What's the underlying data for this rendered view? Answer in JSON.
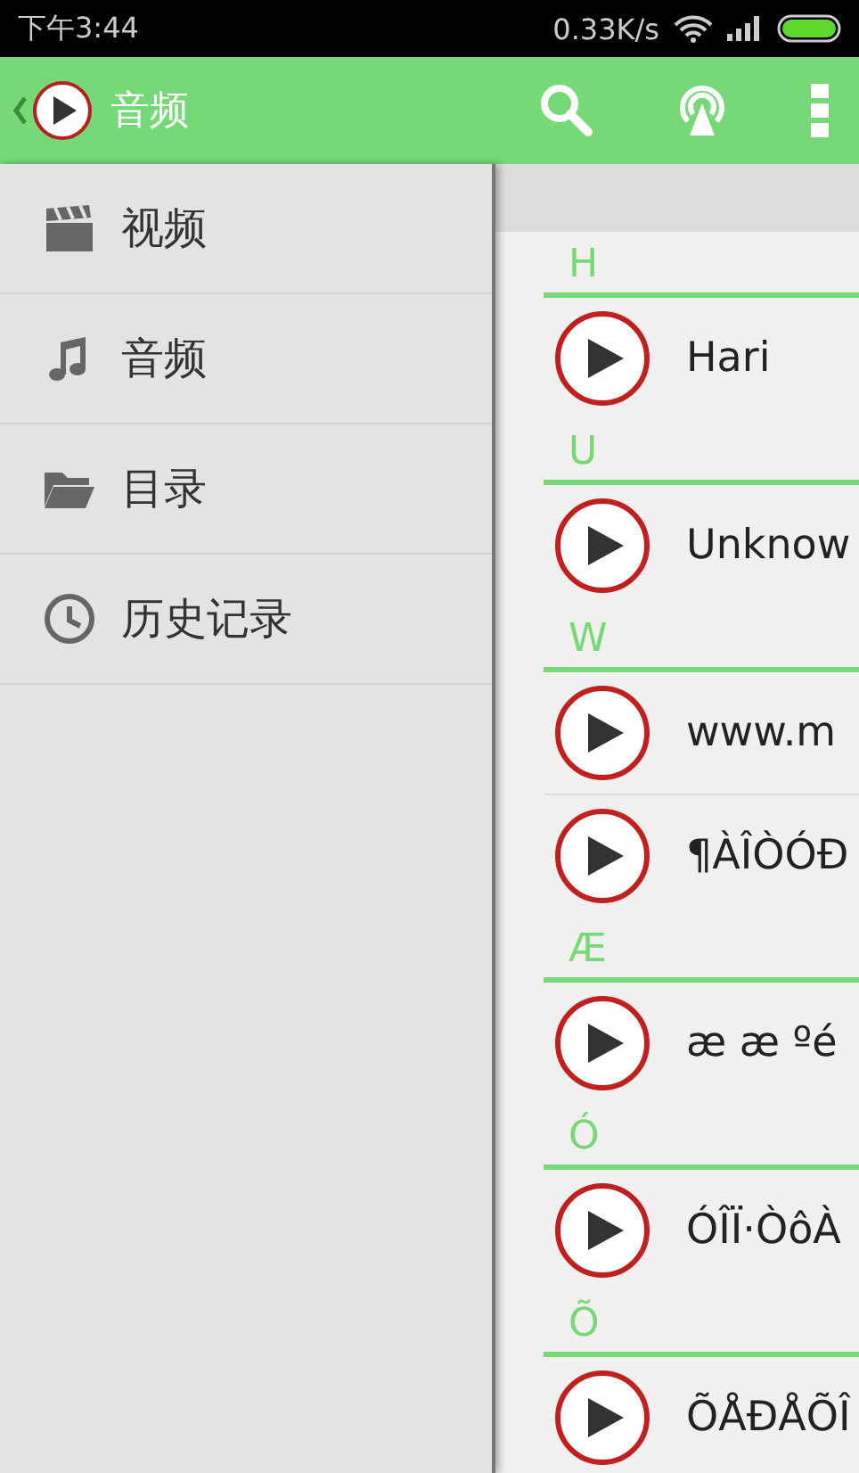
{
  "status_bar": {
    "time": "下午3:44",
    "speed": "0.33K/s"
  },
  "app_bar": {
    "title": "音频"
  },
  "sidebar": {
    "items": [
      {
        "label": "视频",
        "kind": "video"
      },
      {
        "label": "音频",
        "kind": "music"
      },
      {
        "label": "目录",
        "kind": "folder"
      },
      {
        "label": "历史记录",
        "kind": "history"
      }
    ]
  },
  "list": {
    "sections": [
      {
        "letter": "H",
        "items": [
          {
            "title": "Hari"
          }
        ]
      },
      {
        "letter": "U",
        "items": [
          {
            "title": "Unknow"
          }
        ]
      },
      {
        "letter": "W",
        "items": [
          {
            "title": "www.m"
          },
          {
            "title": "¶ÀÎÒÓÐ"
          }
        ]
      },
      {
        "letter": "Æ",
        "items": [
          {
            "title": "æ  æ ºé"
          }
        ]
      },
      {
        "letter": "Ó",
        "items": [
          {
            "title": "ÓÎÏ·ÒôÀ"
          }
        ]
      },
      {
        "letter": "Õ",
        "items": [
          {
            "title": "ÕÅÐÅÕÎ"
          }
        ]
      }
    ]
  }
}
